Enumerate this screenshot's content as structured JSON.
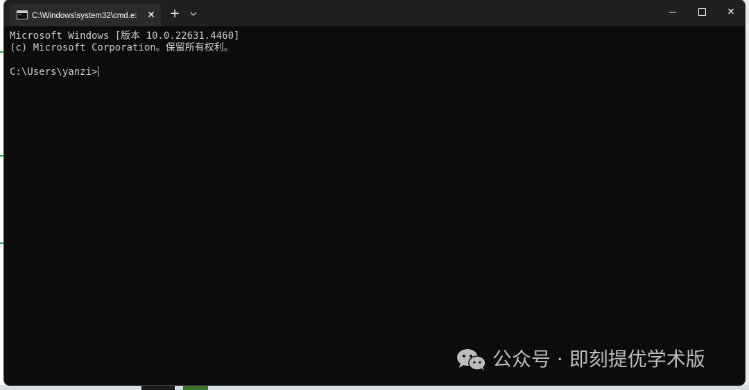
{
  "window": {
    "tab_title": "C:\\Windows\\system32\\cmd.e:",
    "tab_close": "✕",
    "new_tab": "+",
    "dropdown": "⌵",
    "close_glyph": "✕"
  },
  "console": {
    "lines": [
      "Microsoft Windows [版本 10.0.22631.4460]",
      "(c) Microsoft Corporation。保留所有权利。",
      "C:\\Users\\yanzi>"
    ]
  },
  "watermark": {
    "text": "公众号 · 即刻提优学术版"
  },
  "colors": {
    "console_bg": "#0c0c0c",
    "titlebar_bg": "#202020",
    "tab_bg": "#2b2b2b",
    "text": "#cccccc"
  },
  "icons": [
    "cmd-icon",
    "close-icon",
    "plus-icon",
    "chevron-down-icon",
    "minimize-icon",
    "maximize-icon",
    "wechat-icon"
  ]
}
